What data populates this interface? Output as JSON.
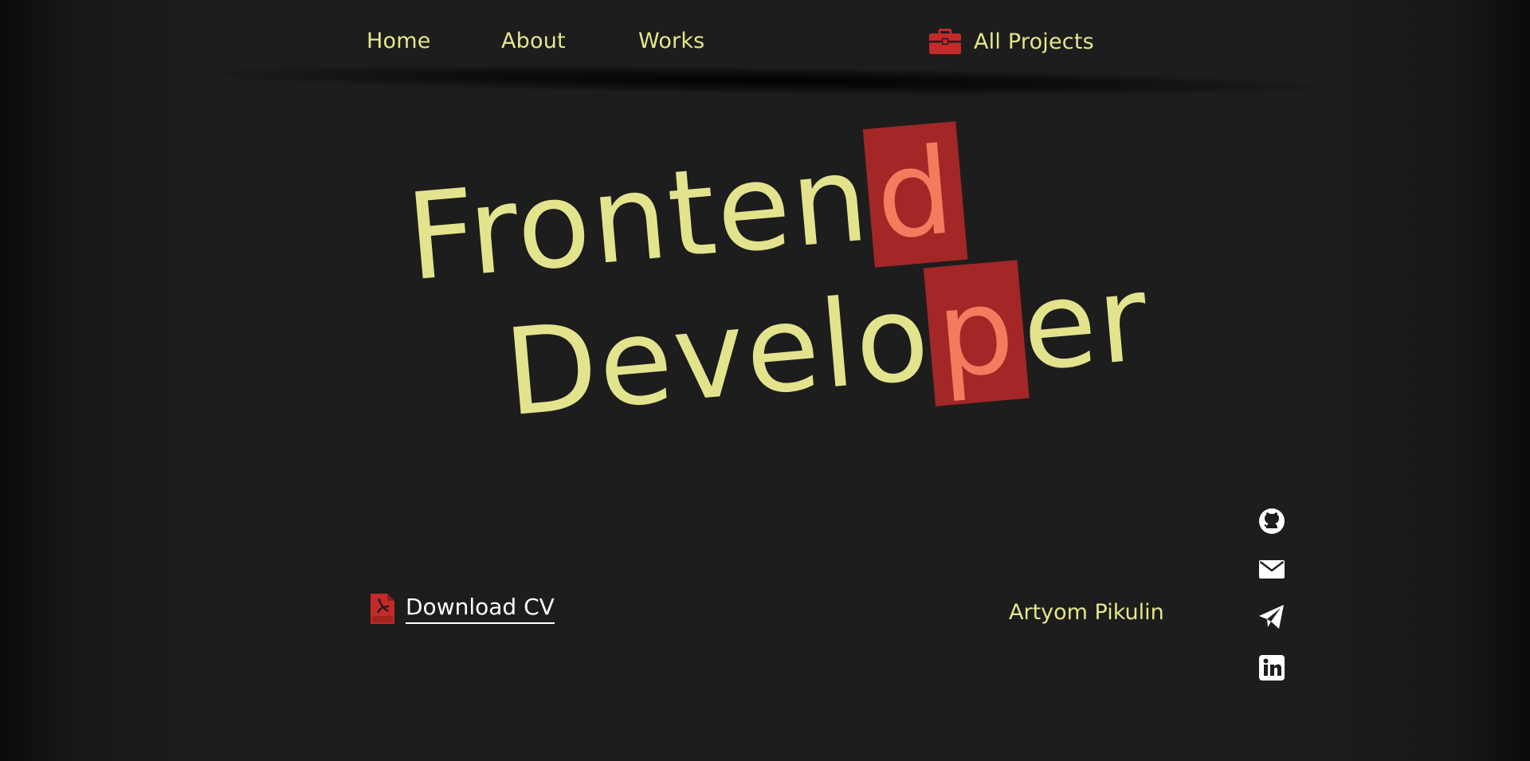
{
  "nav": {
    "home_label": "Home",
    "about_label": "About",
    "works_label": "Works",
    "projects_label": "All Projects",
    "projects_icon": "briefcase-icon"
  },
  "hero": {
    "line1_main": "Fronten",
    "line1_highlight": "d",
    "line2_main": "Develo",
    "line2_highlight": "p",
    "line2_tail": "er"
  },
  "download": {
    "label": "Download CV",
    "icon": "pdf-file-icon"
  },
  "author": {
    "name": "Artyom Pikulin"
  },
  "social": {
    "icons": [
      "github-icon",
      "mail-icon",
      "telegram-icon",
      "linkedin-icon"
    ]
  },
  "colors": {
    "accent_text": "#e6e68a",
    "highlight_bg": "#a32727",
    "highlight_text": "#f47b5e",
    "background": "#1d1d1d",
    "icon_red": "#c32a2a",
    "white": "#ffffff"
  }
}
